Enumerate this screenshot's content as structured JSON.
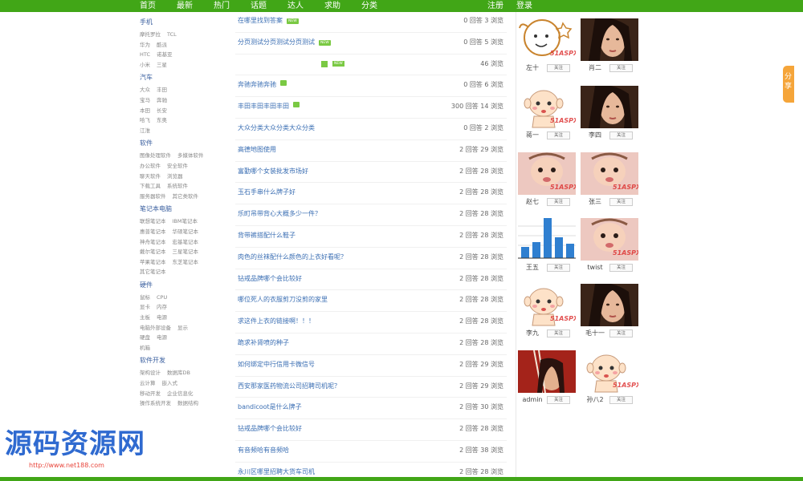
{
  "nav": {
    "items": [
      "首页",
      "最新",
      "热门",
      "话题",
      "达人",
      "求助",
      "分类"
    ],
    "register": "注册",
    "login": "登录"
  },
  "categories": [
    {
      "title": "手机",
      "rows": [
        [
          "摩托罗拉",
          "TCL"
        ],
        [
          "华为",
          "酷派"
        ],
        [
          "HTC",
          "诺基亚"
        ],
        [
          "小米",
          "三星"
        ]
      ]
    },
    {
      "title": "汽车",
      "rows": [
        [
          "大众",
          "丰田"
        ],
        [
          "宝马",
          "奔驰"
        ],
        [
          "本田",
          "长安"
        ],
        [
          "哈飞",
          "东奥"
        ],
        [
          "江淮"
        ]
      ]
    },
    {
      "title": "软件",
      "rows": [
        [
          "图像处理软件",
          "多媒体软件"
        ],
        [
          "办公软件",
          "安全软件"
        ],
        [
          "聊天软件",
          "浏览器"
        ],
        [
          "下载工具",
          "系统软件"
        ],
        [
          "服务器软件",
          "其它类软件"
        ]
      ]
    },
    {
      "title": "笔记本电脑",
      "rows": [
        [
          "联想笔记本",
          "IBM笔记本"
        ],
        [
          "惠普笔记本",
          "华硕笔记本"
        ],
        [
          "神舟笔记本",
          "宏基笔记本"
        ],
        [
          "戴尔笔记本",
          "三星笔记本"
        ],
        [
          "苹果笔记本",
          "东芝笔记本"
        ],
        [
          "其它笔记本"
        ]
      ]
    },
    {
      "title": "硬件",
      "rows": [
        [
          "鼠标",
          "CPU"
        ],
        [
          "显卡",
          "内存"
        ],
        [
          "主板",
          "电源"
        ],
        [
          "电脑外部设备",
          "显示"
        ],
        [
          "硬盘",
          "电源"
        ],
        [
          "机箱"
        ]
      ]
    },
    {
      "title": "软件开发",
      "rows": [
        [
          "架构设计",
          "数据库DB"
        ],
        [
          "云计算",
          "嵌入式"
        ],
        [
          "移动开发",
          "企业信息化"
        ],
        [
          "操作系统开发",
          "数据结构"
        ]
      ]
    }
  ],
  "questions": [
    {
      "title": "在哪里找到答案",
      "badge": "NEW",
      "meta": "0 回答 3 浏览"
    },
    {
      "title": "分页测试分页测试分页测试",
      "badge": "NEW",
      "meta": "0 回答 5 浏览"
    },
    {
      "title": "",
      "badge": "NEW",
      "meta": "46 浏览"
    },
    {
      "title": "奔驰奔驰奔驰",
      "badge": "",
      "meta": "0 回答 6 浏览"
    },
    {
      "title": "丰田丰田丰田丰田",
      "badge": "",
      "meta": "300 回答 14 浏览"
    },
    {
      "title": "大众分类大众分类大众分类",
      "badge": "",
      "meta": "0 回答 2 浏览"
    },
    {
      "title": "高德地图使用",
      "badge": "",
      "meta": "2 回答 29 浏览"
    },
    {
      "title": "富勤哪个女装批发市场好",
      "badge": "",
      "meta": "2 回答 28 浏览"
    },
    {
      "title": "玉石手串什么牌子好",
      "badge": "",
      "meta": "2 回答 28 浏览"
    },
    {
      "title": "乐町吊带背心大概多少一件？",
      "badge": "",
      "meta": "2 回答 28 浏览"
    },
    {
      "title": "背带裤搭配什么鞋子",
      "badge": "",
      "meta": "2 回答 28 浏览"
    },
    {
      "title": "肉色的丝袜配什么颜色的上衣好看呢？",
      "badge": "",
      "meta": "2 回答 28 浏览"
    },
    {
      "title": "钻戒品牌哪个会比较好",
      "badge": "",
      "meta": "2 回答 28 浏览"
    },
    {
      "title": "哪位死人的衣服剪刀没剪的家里",
      "badge": "",
      "meta": "2 回答 28 浏览"
    },
    {
      "title": "求这件上衣的链接啊！！！",
      "badge": "",
      "meta": "2 回答 28 浏览"
    },
    {
      "title": "跪求补肾喷的种子",
      "badge": "",
      "meta": "2 回答 28 浏览"
    },
    {
      "title": "如何绑定中行信用卡微信号",
      "badge": "",
      "meta": "2 回答 29 浏览"
    },
    {
      "title": "西安那家医药物流公司招聘司机呢？",
      "badge": "",
      "meta": "2 回答 29 浏览"
    },
    {
      "title": "bandicoot是什么牌子",
      "badge": "",
      "meta": "2 回答 30 浏览"
    },
    {
      "title": "钻戒品牌哪个会比较好",
      "badge": "",
      "meta": "2 回答 28 浏览"
    },
    {
      "title": "有音频哈有音频哈",
      "badge": "",
      "meta": "2 回答 38 浏览"
    },
    {
      "title": "永川区哪里招聘大货车司机",
      "badge": "",
      "meta": "2 回答 28 浏览"
    }
  ],
  "users": [
    {
      "name": "左十",
      "avatar_kind": "cartoon"
    },
    {
      "name": "肖二",
      "avatar_kind": "photo-dark"
    },
    {
      "name": "蒋一",
      "avatar_kind": "baby"
    },
    {
      "name": "李四",
      "avatar_kind": "photo-dark"
    },
    {
      "name": "赵七",
      "avatar_kind": "baby-photo"
    },
    {
      "name": "张三",
      "avatar_kind": "baby-photo"
    },
    {
      "name": "王五",
      "avatar_kind": "chart"
    },
    {
      "name": "twist",
      "avatar_kind": "baby-photo"
    },
    {
      "name": "李九",
      "avatar_kind": "baby"
    },
    {
      "name": "毛十一",
      "avatar_kind": "photo-dark"
    },
    {
      "name": "admin",
      "avatar_kind": "photo-red"
    },
    {
      "name": "孙八2",
      "avatar_kind": "baby"
    }
  ],
  "follow_label": "关注",
  "avatar_watermark": "51ASPX.com",
  "side_tab": "分享",
  "watermark": {
    "title": "源码资源网",
    "url": "http://www.net188.com"
  },
  "colors": {
    "nav_green": "#41a617",
    "link_blue": "#3a6eb3",
    "badge_green": "#7ac943"
  }
}
